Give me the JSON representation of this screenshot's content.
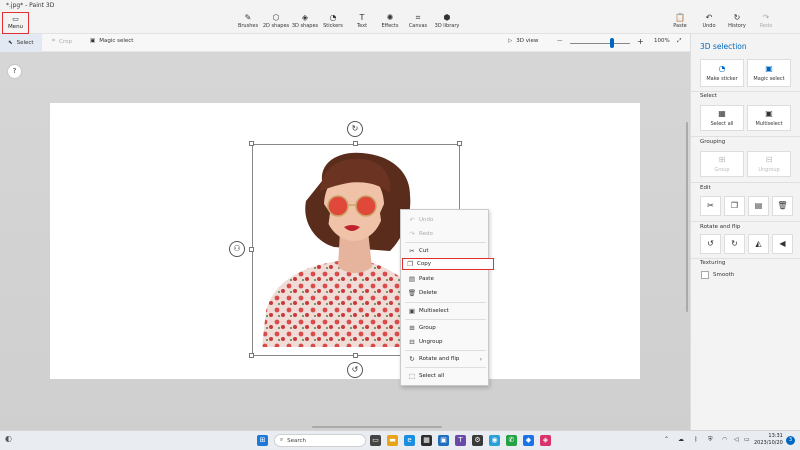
{
  "window": {
    "title": "*.jpg* - Paint 3D"
  },
  "toolbar": {
    "menu_label": "Menu",
    "tools": [
      {
        "label": "Brushes",
        "icon": "brush-icon"
      },
      {
        "label": "2D shapes",
        "icon": "2d-shapes-icon"
      },
      {
        "label": "3D shapes",
        "icon": "3d-shapes-icon"
      },
      {
        "label": "Stickers",
        "icon": "stickers-icon"
      },
      {
        "label": "Text",
        "icon": "text-icon"
      },
      {
        "label": "Effects",
        "icon": "effects-icon"
      },
      {
        "label": "Canvas",
        "icon": "canvas-icon"
      },
      {
        "label": "3D library",
        "icon": "3d-library-icon"
      }
    ],
    "right": [
      {
        "label": "Paste",
        "icon": "paste-icon"
      },
      {
        "label": "Undo",
        "icon": "undo-icon"
      },
      {
        "label": "History",
        "icon": "history-icon"
      },
      {
        "label": "Redo",
        "icon": "redo-icon"
      }
    ]
  },
  "subbar": {
    "select_label": "Select",
    "crop_label": "Crop",
    "magic_select_label": "Magic select",
    "view_3d_label": "3D view",
    "zoom_label": "100%",
    "zoom_level": 0.7
  },
  "context_menu": {
    "items": [
      {
        "label": "Undo",
        "icon": "undo-icon"
      },
      {
        "label": "Redo",
        "icon": "redo-icon"
      },
      {
        "label": "Cut",
        "icon": "scissors-icon"
      },
      {
        "label": "Copy",
        "icon": "copy-icon"
      },
      {
        "label": "Paste",
        "icon": "paste-icon"
      },
      {
        "label": "Delete",
        "icon": "trash-icon"
      },
      {
        "label": "Multiselect",
        "icon": "multiselect-icon"
      },
      {
        "label": "Group",
        "icon": "group-icon"
      },
      {
        "label": "Ungroup",
        "icon": "ungroup-icon"
      },
      {
        "label": "Rotate and flip",
        "icon": "rotate-icon"
      },
      {
        "label": "Select all",
        "icon": "select-all-icon"
      }
    ]
  },
  "panel": {
    "title": "3D selection",
    "make_sticker": "Make sticker",
    "magic_select": "Magic select",
    "select_heading": "Select",
    "select_all": "Select all",
    "multiselect": "Multiselect",
    "grouping_heading": "Grouping",
    "group": "Group",
    "ungroup": "Ungroup",
    "edit_heading": "Edit",
    "rotate_heading": "Rotate and flip",
    "texturing_heading": "Texturing",
    "smooth": "Smooth"
  },
  "taskbar": {
    "search_placeholder": "Search",
    "time": "13:31",
    "date": "2023/10/20",
    "notification_count": "3"
  },
  "colors": {
    "accent": "#0067c0",
    "highlight": "#e03030"
  }
}
